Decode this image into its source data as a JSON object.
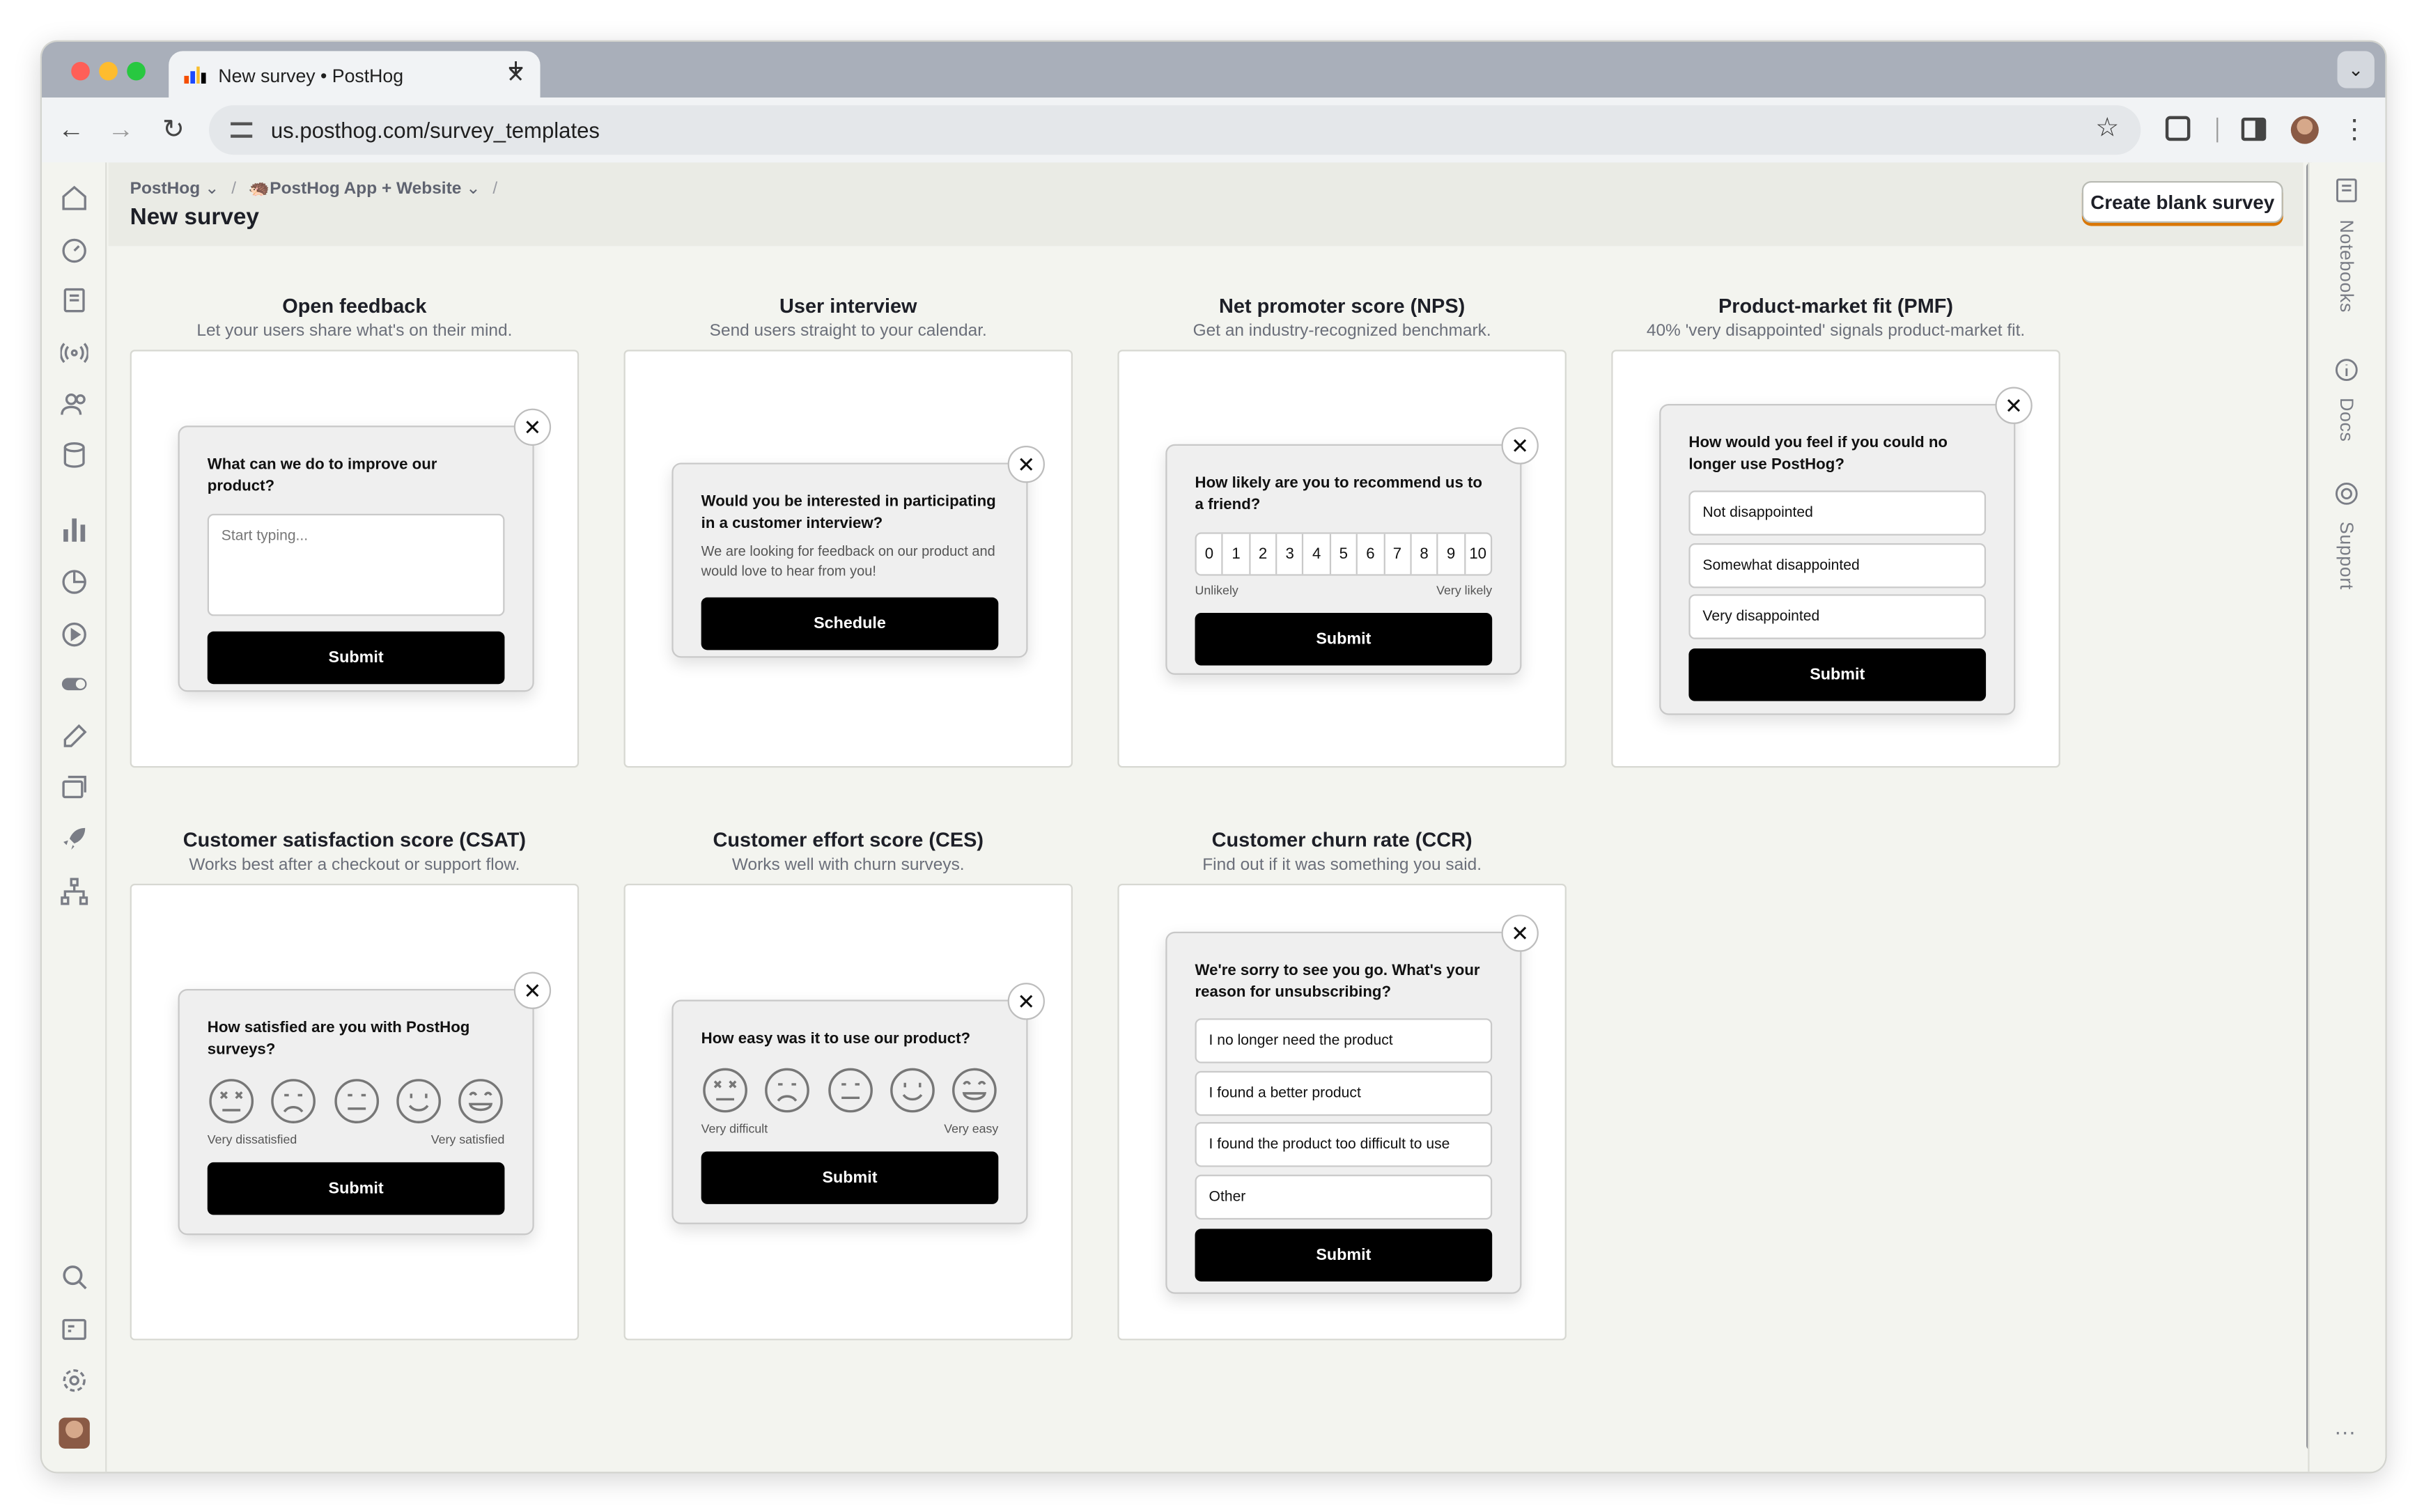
{
  "browser": {
    "tab_title": "New survey • PostHog",
    "tab_close": "✕",
    "new_tab": "+",
    "tab_menu": "⌄",
    "url": "us.posthog.com/survey_templates",
    "back": "←",
    "forward": "→",
    "reload": "↻",
    "bookmark": "☆",
    "menu": "⋮"
  },
  "breadcrumbs": {
    "org": "PostHog",
    "sep1": "/",
    "project": "PostHog App + Website",
    "sep2": "/"
  },
  "page": {
    "title": "New survey",
    "create_blank": "Create blank survey"
  },
  "right_panel": {
    "notebooks": "Notebooks",
    "docs": "Docs",
    "support": "Support",
    "more": "···"
  },
  "templates": [
    {
      "title": "Open feedback",
      "description": "Let your users share what's on their mind.",
      "question": "What can we do to improve our product?",
      "placeholder": "Start typing...",
      "submit": "Submit"
    },
    {
      "title": "User interview",
      "description": "Send users straight to your calendar.",
      "question": "Would you be interested in participating in a customer interview?",
      "question_description": "We are looking for feedback on our product and would love to hear from you!",
      "button": "Schedule"
    },
    {
      "title": "Net promoter score (NPS)",
      "description": "Get an industry-recognized benchmark.",
      "question": "How likely are you to recommend us to a friend?",
      "scale": [
        "0",
        "1",
        "2",
        "3",
        "4",
        "5",
        "6",
        "7",
        "8",
        "9",
        "10"
      ],
      "lower_label": "Unlikely",
      "upper_label": "Very likely",
      "submit": "Submit"
    },
    {
      "title": "Product-market fit (PMF)",
      "description": "40% 'very disappointed' signals product-market fit.",
      "question": "How would you feel if you could no longer use PostHog?",
      "options": [
        "Not disappointed",
        "Somewhat disappointed",
        "Very disappointed"
      ],
      "submit": "Submit"
    },
    {
      "title": "Customer satisfaction score (CSAT)",
      "description": "Works best after a checkout or support flow.",
      "question": "How satisfied are you with PostHog surveys?",
      "lower_label": "Very dissatisfied",
      "upper_label": "Very satisfied",
      "submit": "Submit"
    },
    {
      "title": "Customer effort score (CES)",
      "description": "Works well with churn surveys.",
      "question": "How easy was it to use our product?",
      "lower_label": "Very difficult",
      "upper_label": "Very easy",
      "submit": "Submit"
    },
    {
      "title": "Customer churn rate (CCR)",
      "description": "Find out if it was something you said.",
      "question": "We're sorry to see you go. What's your reason for unsubscribing?",
      "options": [
        "I no longer need the product",
        "I found a better product",
        "I found the product too difficult to use",
        "Other"
      ],
      "submit": "Submit"
    }
  ],
  "close_glyph": "✕",
  "colors": {
    "accent_shadow": "#d97706",
    "submit_bg": "#000000",
    "page_bg": "#f3f4ef"
  }
}
